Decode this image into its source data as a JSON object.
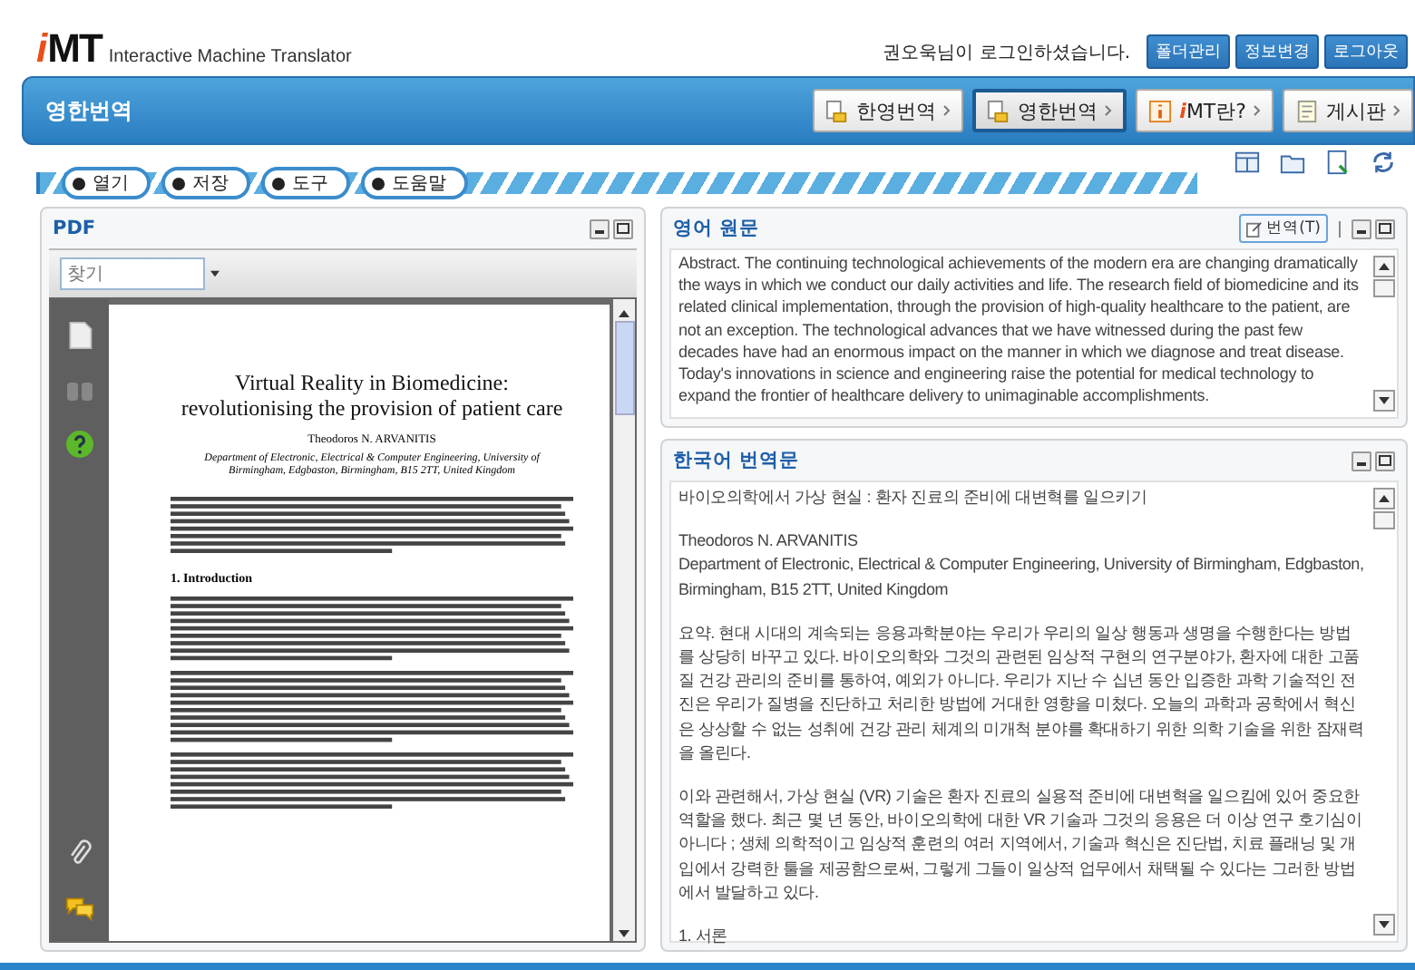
{
  "logo": {
    "accent": "i",
    "text": "MT",
    "subtitle": "Interactive Machine Translator"
  },
  "user_message": "권오욱님이 로그인하셨습니다.",
  "account_buttons": [
    "폴더관리",
    "정보변경",
    "로그아웃"
  ],
  "page_title": "영한번역",
  "menu": [
    {
      "label": "한영번역",
      "kind": "translate",
      "selected": false
    },
    {
      "label": "영한번역",
      "kind": "translate",
      "selected": true
    },
    {
      "accent": "i",
      "label": "MT란?",
      "kind": "about",
      "selected": false
    },
    {
      "label": "게시판",
      "kind": "board",
      "selected": false
    }
  ],
  "tabs": [
    "열기",
    "저장",
    "도구",
    "도움말"
  ],
  "pdf_panel": {
    "title": "PDF",
    "search": {
      "placeholder": "찾기"
    },
    "document": {
      "title": "Virtual Reality in Biomedicine: revolutionising the provision of patient care",
      "author": "Theodoros N. ARVANITIS",
      "affiliation": "Department of Electronic, Electrical & Computer Engineering, University of Birmingham, Edgbaston, Birmingham, B15 2TT, United Kingdom",
      "section": "1. Introduction"
    }
  },
  "source_panel": {
    "title": "영어 원문",
    "translate_button": "번역(T)",
    "text": "Abstract. The continuing technological achievements of the modern era are changing dramatically the ways in which we conduct our daily activities and life. The research field of biomedicine and its related clinical implementation, through the provision of high-quality healthcare to the patient, are not an exception. The technological advances that we have witnessed during the past few decades have had an enormous impact on the manner in which we diagnose and treat disease. Today's innovations in science and engineering raise the potential for medical technology to expand the frontier of healthcare delivery to unimaginable accomplishments."
  },
  "target_panel": {
    "title": "한국어 번역문",
    "paragraphs": [
      [
        "바이오의학에서 가상 현실 :  환자 진료의 준비에 대변혁를 일으키기"
      ],
      [
        "Theodoros N. ARVANITIS",
        "Department of Electronic, Electrical & Computer Engineering, University of Birmingham, Edgbaston, Birmingham, B15 2TT, United Kingdom"
      ],
      [
        "요약.  현대 시대의 계속되는 응용과학분야는 우리가 우리의 일상 행동과 생명을 수행한다는 방법를 상당히 바꾸고 있다.  바이오의학와 그것의 관련된 임상적 구현의 연구분야가, 환자에 대한 고품질 건강 관리의 준비를 통하여, 예외가 아니다.  우리가 지난 수 십년 동안 입증한 과학 기술적인 전진은 우리가 질병을 진단하고 처리한 방법에 거대한 영향을 미쳤다.  오늘의 과학과 공학에서 혁신은 상상할 수 없는 성취에 건강 관리 체계의 미개척 분야를 확대하기 위한 의학 기술을 위한 잠재력을 올린다."
      ],
      [
        "이와 관련해서, 가상 현실 (VR) 기술은 환자 진료의 실용적 준비에 대변혁을 일으킴에 있어 중요한 역할을 했다.  최근 몇 년 동안, 바이오의학에 대한 VR 기술과 그것의 응용은 더 이상 연구 호기심이 아니다 ;  생체 의학적이고 임상적 훈련의 여러 지역에서, 기술과 혁신은 진단법, 치료 플래닝 및 개입에서 강력한 툴을 제공함으로써, 그렇게 그들이 일상적 업무에서 채택될 수 있다는 그러한 방법에서 발달하고 있다."
      ],
      [
        "1.  서론"
      ]
    ]
  }
}
